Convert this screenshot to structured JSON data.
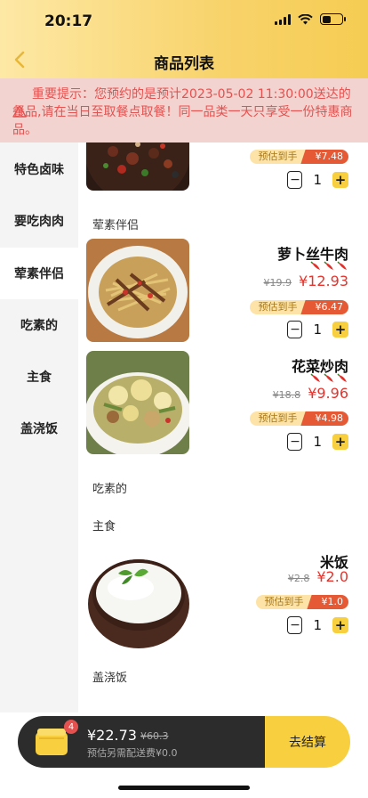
{
  "status": {
    "time": "20:17"
  },
  "nav": {
    "title": "商品列表",
    "back_icon": "chevron-left-icon"
  },
  "notice": {
    "text": "重要提示：您预约的是预计2023-05-02 11:30:00送达的餐品,请在当日至取餐点取餐！同一品类一天只享受一份特惠商品。"
  },
  "sidebar": {
    "items": [
      {
        "label": "特色卤味"
      },
      {
        "label": "要吃肉肉"
      },
      {
        "label": "荤素伴侣",
        "active": true
      },
      {
        "label": "吃素的"
      },
      {
        "label": "主食"
      },
      {
        "label": "盖浇饭"
      }
    ]
  },
  "sections": {
    "hunsu": "荤素伴侣",
    "chisu": "吃素的",
    "zhushi": "主食",
    "gaijiaofan": "盖浇饭"
  },
  "products": {
    "partial": {
      "est_label": "预估到手",
      "est_value": "¥7.48",
      "qty": "1"
    },
    "luobo": {
      "name": "萝卜丝牛肉",
      "spicy": 3,
      "orig_price": "¥19.9",
      "price": "¥12.93",
      "est_label": "预估到手",
      "est_value": "¥6.47",
      "qty": "1"
    },
    "huacai": {
      "name": "花菜炒肉",
      "spicy": 3,
      "orig_price": "¥18.8",
      "price": "¥9.96",
      "est_label": "预估到手",
      "est_value": "¥4.98",
      "qty": "1"
    },
    "mifan": {
      "name": "米饭",
      "orig_price": "¥2.8",
      "price": "¥2.0",
      "est_label": "预估到手",
      "est_value": "¥1.0",
      "qty": "1"
    }
  },
  "cart": {
    "count": "4",
    "total": "¥22.73",
    "orig_total": "¥60.3",
    "delivery": "预估另需配送费¥0.0",
    "checkout_label": "去结算"
  },
  "colors": {
    "accent": "#f7cf3f",
    "price": "#e5342d",
    "notice_bg": "#f3d3d0",
    "notice_text": "#e5514f"
  }
}
